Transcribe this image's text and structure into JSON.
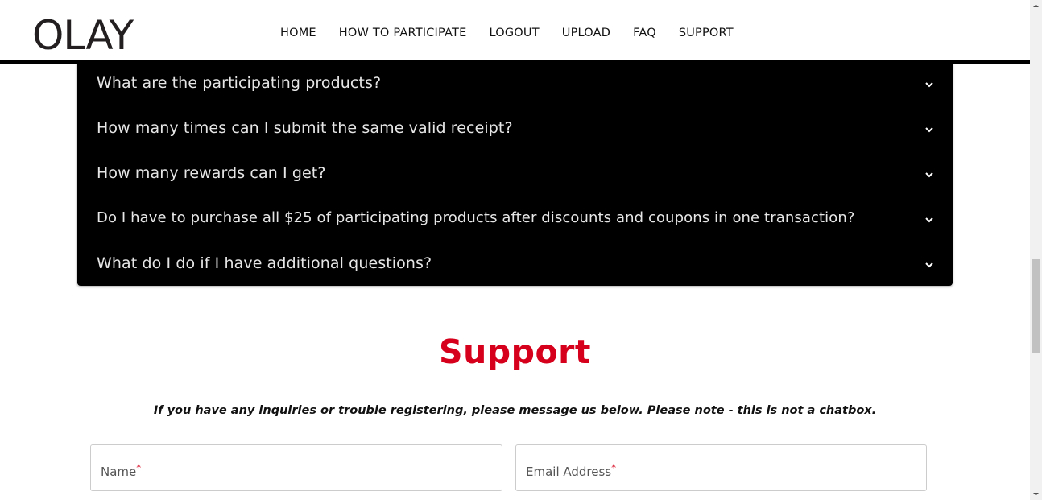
{
  "header": {
    "logo_text": "OLAY",
    "nav": [
      "HOME",
      "HOW TO PARTICIPATE",
      "LOGOUT",
      "UPLOAD",
      "FAQ",
      "SUPPORT"
    ]
  },
  "faq": {
    "questions": [
      "What are the participating products?",
      "How many times can I submit the same valid receipt?",
      "How many rewards can I get?",
      "Do I have to purchase all $25 of participating products after discounts and coupons in one transaction?",
      "What do I do if I have additional questions?"
    ],
    "chevron_icon": "chevron-down-icon"
  },
  "support": {
    "title": "Support",
    "note": "If you have any inquiries or trouble registering, please message us below. Please note - this is not a chatbox.",
    "name_label": "Name",
    "email_label": "Email Address",
    "required_mark": "*"
  },
  "colors": {
    "brand_red": "#d6001c",
    "faq_bg": "#000000",
    "faq_text": "#e6e6e6"
  }
}
